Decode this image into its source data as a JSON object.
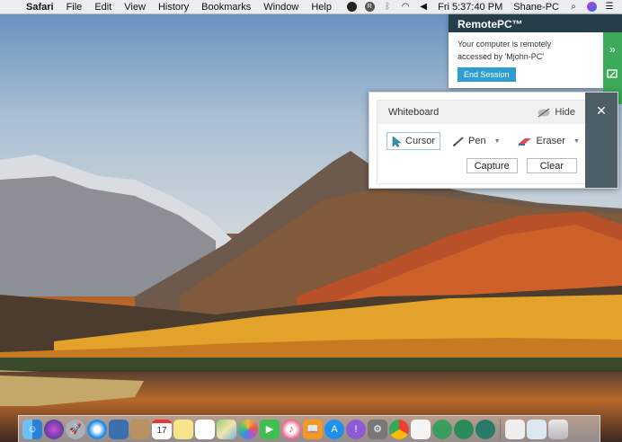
{
  "menubar": {
    "app_name": "Safari",
    "items": [
      "File",
      "Edit",
      "View",
      "History",
      "Bookmarks",
      "Window",
      "Help"
    ],
    "clock": "Fri 5:37:40 PM",
    "user": "Shane-PC"
  },
  "remotepc": {
    "title": "RemotePC™",
    "message_line1": "Your computer is remotely",
    "message_line2": "accessed by 'Mjohn-PC'",
    "end_session_label": "End Session",
    "accent_color": "#3caa5a",
    "header_color": "#243f4a"
  },
  "whiteboard": {
    "title": "Whiteboard",
    "hide_label": "Hide",
    "tools": [
      {
        "name": "cursor",
        "label": "Cursor",
        "icon": "cursor-icon"
      },
      {
        "name": "pen",
        "label": "Pen",
        "icon": "pen-icon"
      },
      {
        "name": "eraser",
        "label": "Eraser",
        "icon": "eraser-icon"
      }
    ],
    "capture_label": "Capture",
    "clear_label": "Clear",
    "close_glyph": "✕"
  },
  "dock": {
    "icons": [
      "finder",
      "siri",
      "launchpad",
      "safari",
      "photo-viewer",
      "contacts",
      "calendar",
      "notes",
      "reminders",
      "maps",
      "photos",
      "facetime",
      "itunes",
      "ibooks",
      "app-store",
      "system-preferences",
      "remote",
      "chrome",
      "textedit",
      "remotepc-1",
      "remotepc-2",
      "remotepc-3",
      "documents",
      "finder-window",
      "trash"
    ],
    "calendar_day": "17"
  }
}
